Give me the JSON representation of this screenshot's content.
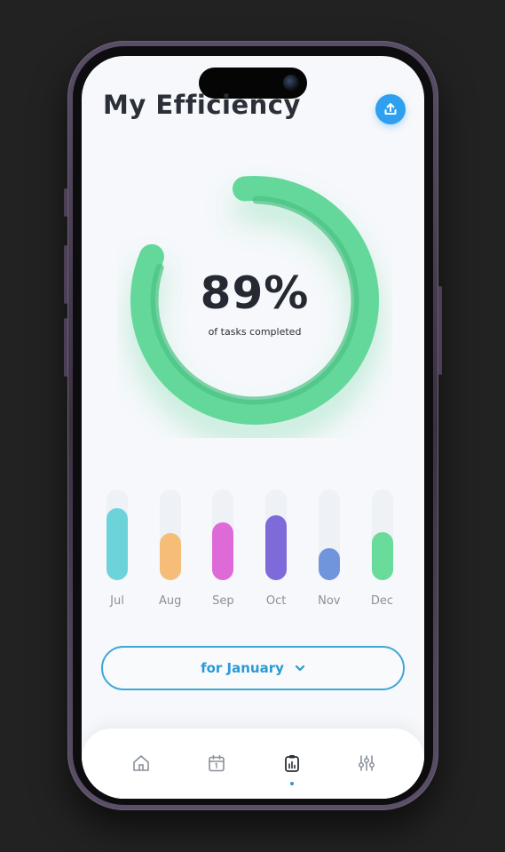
{
  "header": {
    "title": "My Efficiency",
    "share_icon": "upload-icon"
  },
  "progress": {
    "value_text": "89%",
    "value": 0.89,
    "label": "of tasks completed",
    "color": "#63d89a"
  },
  "chart_data": {
    "type": "bar",
    "categories": [
      "Jul",
      "Aug",
      "Sep",
      "Oct",
      "Nov",
      "Dec"
    ],
    "values": [
      0.79,
      0.52,
      0.64,
      0.72,
      0.35,
      0.53
    ],
    "colors": [
      "#6dd3da",
      "#f5bd78",
      "#de6ad8",
      "#7e6ad8",
      "#7195dc",
      "#69db9a"
    ],
    "ylim": [
      0,
      1
    ],
    "grid": false
  },
  "filter": {
    "label": "for January",
    "icon": "chevron-down-icon"
  },
  "nav": {
    "items": [
      {
        "name": "home",
        "icon": "home-icon",
        "active": false
      },
      {
        "name": "calendar",
        "icon": "calendar-icon",
        "active": false
      },
      {
        "name": "reports",
        "icon": "report-clipboard-icon",
        "active": true
      },
      {
        "name": "settings",
        "icon": "sliders-icon",
        "active": false
      }
    ],
    "active_color": "#2a9ad4"
  }
}
